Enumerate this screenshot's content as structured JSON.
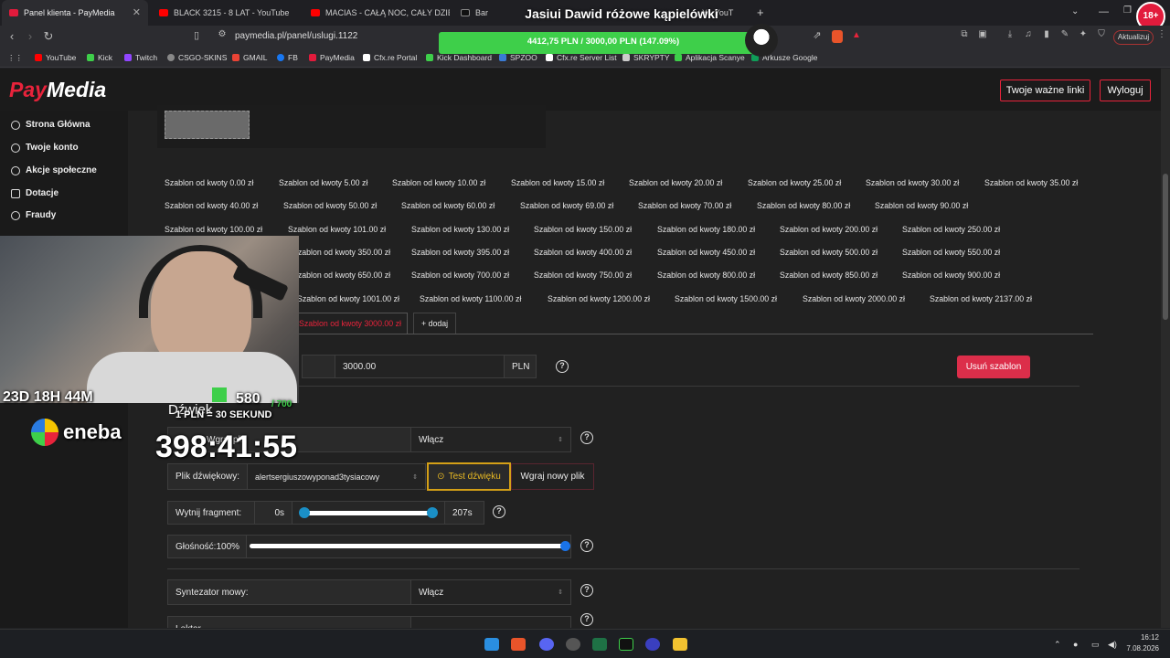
{
  "tabs": [
    {
      "label": "Panel klienta - PayMedia"
    },
    {
      "label": "BLACK 3215 - 8 LAT - YouTube"
    },
    {
      "label": "MACIAS - CAŁĄ NOC, CAŁY DZIEŃ -"
    },
    {
      "label": "Bar"
    },
    {
      "label": "Y - YouT"
    }
  ],
  "new_tab": "+",
  "url": "paymedia.pl/panel/uslugi.1122",
  "ext_badge": "Aktualizuj",
  "bookmarks": [
    "YouTube",
    "Kick",
    "Twitch",
    "CSGO-SKINS",
    "GMAIL",
    "FB",
    "PayMedia",
    "Cfx.re Portal",
    "Kick Dashboard",
    "SPZOO",
    "Cfx.re Server List",
    "SKRYPTY",
    "Aplikacja Scanye",
    "Arkusze Google"
  ],
  "overlay": {
    "goal_title": "Jasiui Dawid różowe kąpielówki",
    "goal_progress": "4412,75 PLN / 3000,00 PLN  (147.09%)",
    "goal_fraction": 1.4709,
    "timer_days": "23D 18H 44M",
    "kick_count": "580",
    "kick_max": "/ 700",
    "rate": "1 PLN = 30 SEKUND",
    "countdown": "398:41:55",
    "sponsor": "eneba"
  },
  "header": {
    "logo_pay": "Pay",
    "logo_media": "Media",
    "links_button": "Twoje ważne linki",
    "logout_button": "Wyloguj"
  },
  "sidebar": {
    "items": [
      {
        "label": "Strona Główna"
      },
      {
        "label": "Twoje konto"
      },
      {
        "label": "Akcje społeczne"
      },
      {
        "label": "Dotacje"
      },
      {
        "label": "Fraudy"
      }
    ]
  },
  "templates": {
    "row1": [
      "Szablon od kwoty 0.00 zł",
      "Szablon od kwoty 5.00 zł",
      "Szablon od kwoty 10.00 zł",
      "Szablon od kwoty 15.00 zł",
      "Szablon od kwoty 20.00 zł",
      "Szablon od kwoty 25.00 zł",
      "Szablon od kwoty 30.00 zł",
      "Szablon od kwoty 35.00 zł"
    ],
    "row2": [
      "Szablon od kwoty 40.00 zł",
      "Szablon od kwoty 50.00 zł",
      "Szablon od kwoty 60.00 zł",
      "Szablon od kwoty 69.00 zł",
      "Szablon od kwoty 70.00 zł",
      "Szablon od kwoty 80.00 zł",
      "Szablon od kwoty 90.00 zł"
    ],
    "row3": [
      "Szablon od kwoty 100.00 zł",
      "Szablon od kwoty 101.00 zł",
      "Szablon od kwoty 130.00 zł",
      "Szablon od kwoty 150.00 zł",
      "Szablon od kwoty 180.00 zł",
      "Szablon od kwoty 200.00 zł",
      "Szablon od kwoty 250.00 zł"
    ],
    "row4": [
      "Szablon od kwoty 350.00 zł",
      "Szablon od kwoty 395.00 zł",
      "Szablon od kwoty 400.00 zł",
      "Szablon od kwoty 450.00 zł",
      "Szablon od kwoty 500.00 zł",
      "Szablon od kwoty 550.00 zł"
    ],
    "row5": [
      "Szablon od kwoty 650.00 zł",
      "Szablon od kwoty 700.00 zł",
      "Szablon od kwoty 750.00 zł",
      "Szablon od kwoty 800.00 zł",
      "Szablon od kwoty 850.00 zł",
      "Szablon od kwoty 900.00 zł"
    ],
    "row6": [
      "Szablon od kwoty 1001.00 zł",
      "Szablon od kwoty 1100.00 zł",
      "Szablon od kwoty 1200.00 zł",
      "Szablon od kwoty 1500.00 zł",
      "Szablon od kwoty 2000.00 zł",
      "Szablon od kwoty 2137.00 zł"
    ],
    "active": "Szablon od kwoty 3000.00 zł",
    "add": "+ dodaj"
  },
  "form": {
    "amount_value": "3000.00",
    "amount_unit": "PLN",
    "delete_button": "Usuń szablon",
    "sound_heading": "Dźwięk",
    "sound_toggle_label": "Wgraj plik",
    "sound_toggle_value": "Włącz",
    "file_label": "Plik dźwiękowy:",
    "file_value": "alertsergiuszowyponad3tysiacowy",
    "test_button": "Test dźwięku",
    "upload_button": "Wgraj nowy plik",
    "trim_label": "Wytnij fragment:",
    "trim_start": "0s",
    "trim_end": "207s",
    "volume_label": "Głośność:100%",
    "volume_fraction": 1.0,
    "tts_label": "Syntezator mowy:",
    "tts_value": "Włącz",
    "next_label": "Lektor"
  },
  "taskbar": {
    "time": "16:12",
    "date": "7.08.2026"
  },
  "colors": {
    "accent": "#e8233b",
    "goal_green": "#3ecf4a",
    "test_border": "#d4a017"
  }
}
